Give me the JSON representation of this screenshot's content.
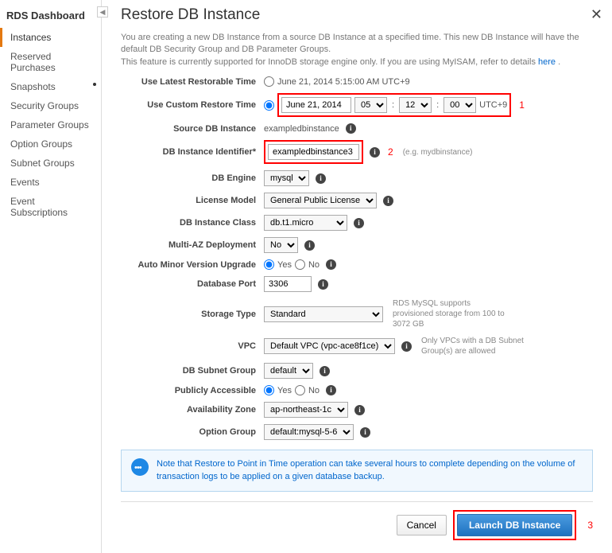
{
  "sidebar": {
    "title": "RDS Dashboard",
    "items": [
      {
        "label": "Instances"
      },
      {
        "label": "Reserved Purchases"
      },
      {
        "label": "Snapshots"
      },
      {
        "label": "Security Groups"
      },
      {
        "label": "Parameter Groups"
      },
      {
        "label": "Option Groups"
      },
      {
        "label": "Subnet Groups"
      },
      {
        "label": "Events"
      },
      {
        "label": "Event Subscriptions"
      }
    ]
  },
  "page": {
    "title": "Restore DB Instance",
    "intro_line1": "You are creating a new DB Instance from a source DB Instance at a specified time. This new DB Instance will have the default DB Security Group and DB Parameter Groups.",
    "intro_line2": "This feature is currently supported for InnoDB storage engine only. If you are using MyISAM, refer to details ",
    "intro_link": "here"
  },
  "form": {
    "latest_label": "Use Latest Restorable Time",
    "latest_value": "June 21, 2014 5:15:00 AM UTC+9",
    "custom_label": "Use Custom Restore Time",
    "custom_date": "June 21, 2014",
    "custom_hh": "05",
    "custom_mm": "12",
    "custom_ss": "00",
    "custom_tz": "UTC+9",
    "source_label": "Source DB Instance",
    "source_value": "exampledbinstance",
    "identifier_label": "DB Instance Identifier*",
    "identifier_value": "exampledbinstance3",
    "identifier_hint": "(e.g. mydbinstance)",
    "engine_label": "DB Engine",
    "engine_value": "mysql",
    "license_label": "License Model",
    "license_value": "General Public License",
    "class_label": "DB Instance Class",
    "class_value": "db.t1.micro",
    "multiaz_label": "Multi-AZ Deployment",
    "multiaz_value": "No",
    "autominor_label": "Auto Minor Version Upgrade",
    "autominor_yes": "Yes",
    "autominor_no": "No",
    "port_label": "Database Port",
    "port_value": "3306",
    "storage_label": "Storage Type",
    "storage_value": "Standard",
    "storage_hint": "RDS MySQL supports provisioned storage from 100 to 3072 GB",
    "vpc_label": "VPC",
    "vpc_value": "Default VPC (vpc-ace8f1ce)",
    "vpc_hint": "Only VPCs with a DB Subnet Group(s) are allowed",
    "subnet_label": "DB Subnet Group",
    "subnet_value": "default",
    "public_label": "Publicly Accessible",
    "public_yes": "Yes",
    "public_no": "No",
    "az_label": "Availability Zone",
    "az_value": "ap-northeast-1c",
    "optiongrp_label": "Option Group",
    "optiongrp_value": "default:mysql-5-6"
  },
  "notice": "Note that Restore to Point in Time operation can take several hours to complete depending on the volume of transaction logs to be applied on a given database backup.",
  "footer": {
    "cancel": "Cancel",
    "launch": "Launch DB Instance"
  },
  "annotations": {
    "a1": "1",
    "a2": "2",
    "a3": "3"
  }
}
